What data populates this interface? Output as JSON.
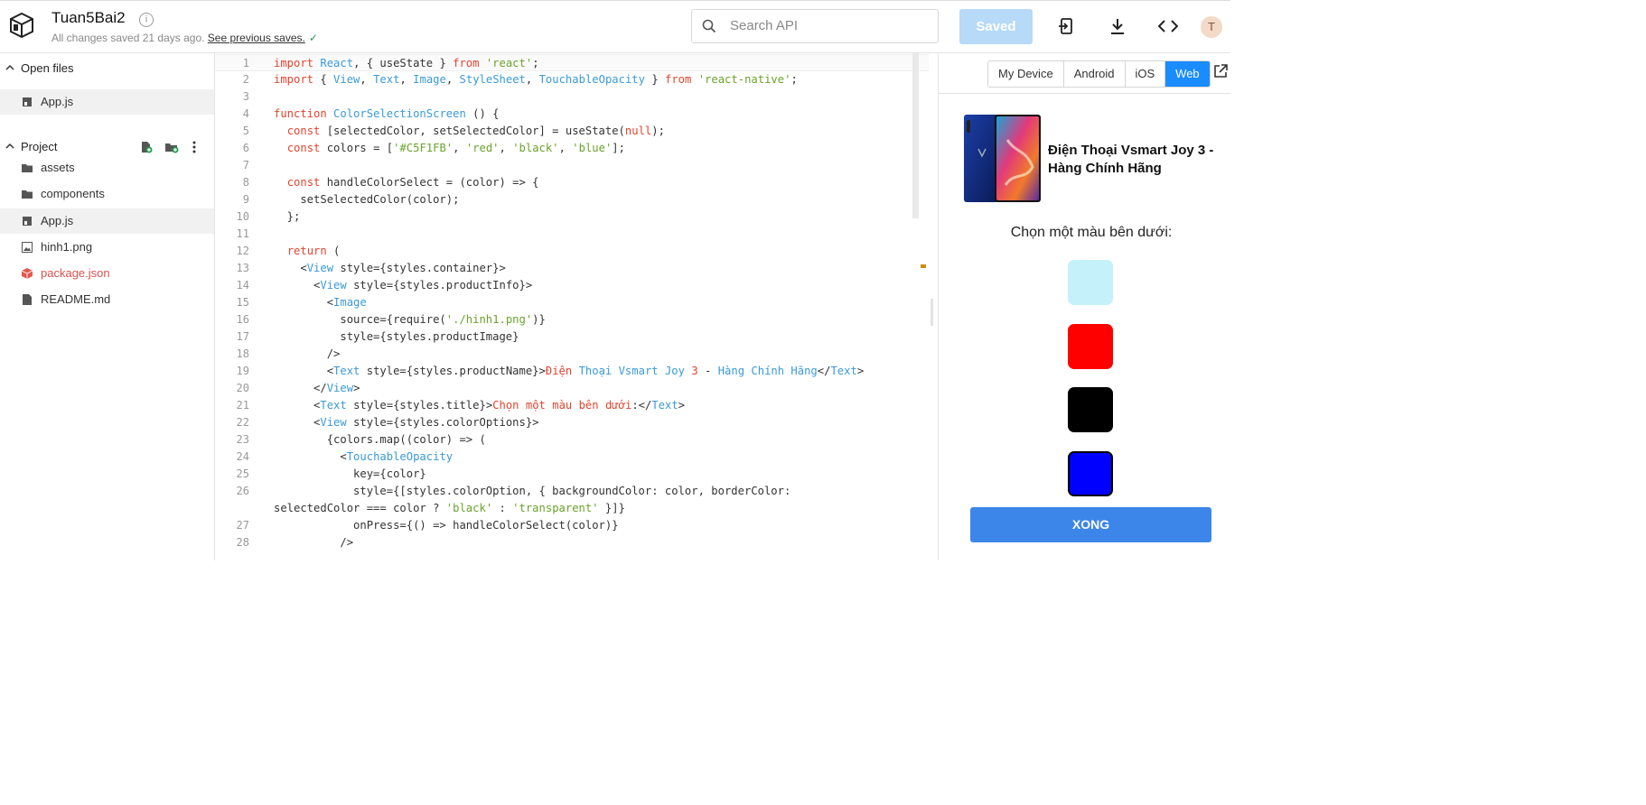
{
  "header": {
    "project_title": "Tuan5Bai2",
    "save_status": "All changes saved 21 days ago.",
    "previous_saves_link": "See previous saves.",
    "search_placeholder": "Search API",
    "saved_button": "Saved",
    "avatar_initial": "T"
  },
  "sidebar": {
    "open_files_label": "Open files",
    "open_files": [
      {
        "name": "App.js"
      }
    ],
    "project_label": "Project",
    "project_items": [
      {
        "name": "assets",
        "icon": "folder-icon"
      },
      {
        "name": "components",
        "icon": "folder-icon"
      },
      {
        "name": "App.js",
        "icon": "js-file-icon"
      },
      {
        "name": "hinh1.png",
        "icon": "image-file-icon"
      },
      {
        "name": "package.json",
        "icon": "package-icon"
      },
      {
        "name": "README.md",
        "icon": "file-icon"
      }
    ]
  },
  "editor": {
    "line_numbers": [
      "1",
      "2",
      "3",
      "4",
      "5",
      "6",
      "7",
      "8",
      "9",
      "10",
      "11",
      "12",
      "13",
      "14",
      "15",
      "16",
      "17",
      "18",
      "19",
      "20",
      "21",
      "22",
      "23",
      "24",
      "25",
      "26",
      "",
      "27",
      "28"
    ]
  },
  "preview": {
    "device_tabs": [
      "My Device",
      "Android",
      "iOS",
      "Web"
    ],
    "active_tab": "Web",
    "product_name": "Điện Thoại Vsmart Joy 3 - Hàng Chính Hãng",
    "title": "Chọn một màu bên dưới:",
    "colors": [
      "#C5F1FB",
      "red",
      "black",
      "blue"
    ],
    "done_button": "XONG"
  }
}
